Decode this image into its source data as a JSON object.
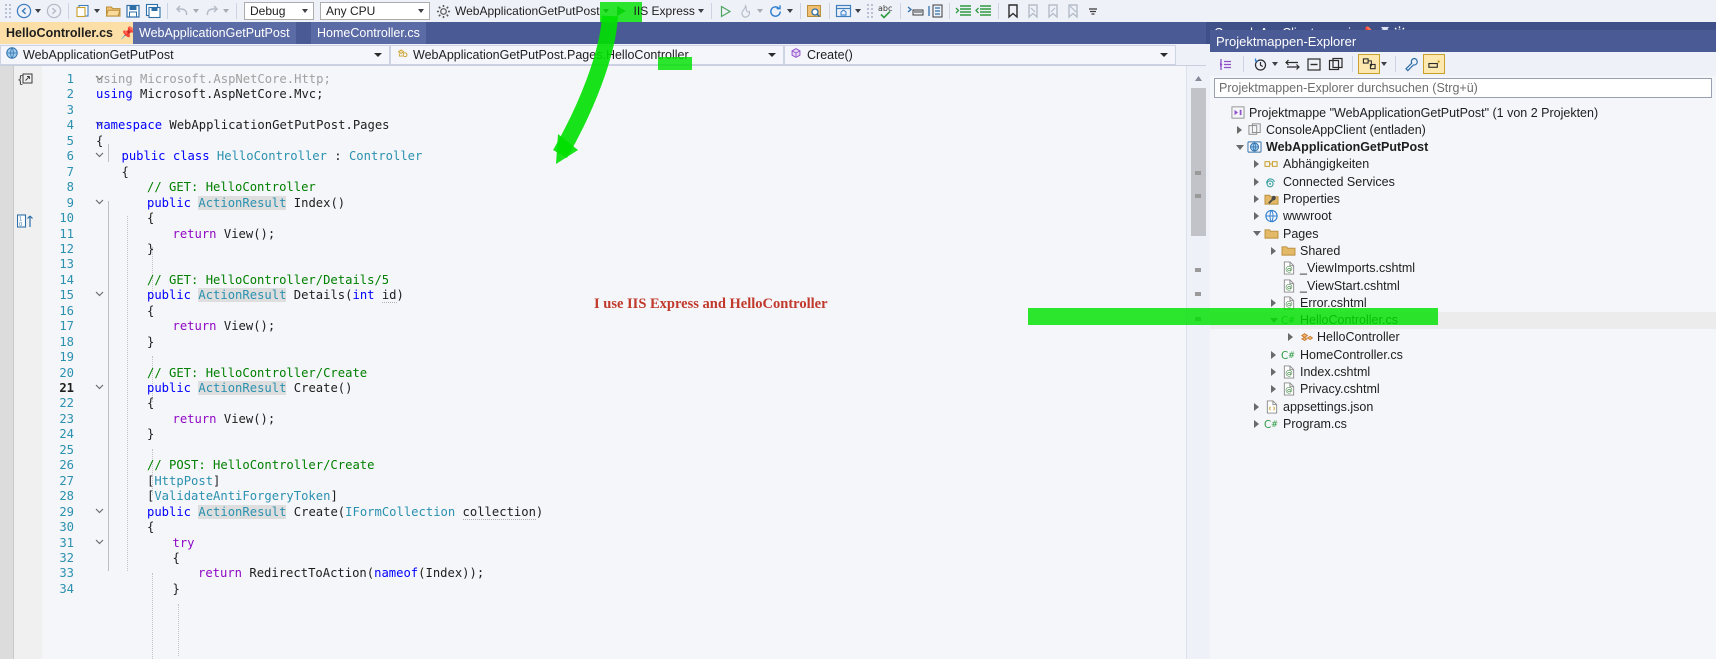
{
  "toolbar": {
    "nav_back_icon": "navigate-back-icon",
    "nav_forward_icon": "navigate-forward-icon",
    "new_item_icon": "new-item-icon",
    "open_icon": "open-file-icon",
    "save_icon": "save-icon",
    "save_all_icon": "save-all-icon",
    "undo_icon": "undo-icon",
    "redo_icon": "redo-icon",
    "config_value": "Debug",
    "platform_value": "Any CPU",
    "startup_project": "WebApplicationGetPutPost",
    "run_target": "IIS Express",
    "attach_icon": "attach-process-icon",
    "hot_reload_icon": "hot-reload-icon",
    "refresh_icon": "refresh-icon",
    "find_in_files_icon": "find-in-files-icon",
    "window_layout_icon": "window-layout-icon",
    "spell_icon": "spell-check-icon",
    "comment_icon": "comment-selection-icon",
    "uncomment_icon": "uncomment-selection-icon",
    "indent_icon": "increase-indent-icon",
    "outdent_icon": "decrease-indent-icon",
    "bookmark_icon": "toggle-bookmark-icon",
    "prev_bookmark_icon": "previous-bookmark-icon",
    "next_bookmark_icon": "next-bookmark-icon",
    "clear_bookmark_icon": "clear-bookmarks-icon",
    "overflow_icon": "toolbar-overflow-icon"
  },
  "tabs": {
    "items": [
      {
        "label": "HelloController.cs",
        "state": "active"
      },
      {
        "label": "WebApplicationGetPutPost",
        "state": "inactive"
      },
      {
        "label": "HomeController.cs",
        "state": "inactive"
      }
    ],
    "right_doc": "ConsoleAppClient.csproj",
    "pin_glyph": "✐",
    "close_glyph": "✕"
  },
  "navbar": {
    "project": "WebApplicationGetPutPost",
    "type": "WebApplicationGetPutPost.Pages.HelloController",
    "member": "Create()",
    "project_icon": "web-project-icon",
    "type_icon": "class-icon",
    "member_icon": "method-icon"
  },
  "editor": {
    "current_line": 21,
    "lines": [
      {
        "n": 1,
        "fold": "v",
        "indent": 0,
        "tokens": [
          {
            "t": "using Microsoft.AspNetCore.Http;",
            "c": "gry"
          }
        ]
      },
      {
        "n": 2,
        "fold": "",
        "indent": 0,
        "tokens": [
          {
            "t": "using",
            "c": "kw"
          },
          {
            "t": " Microsoft.AspNetCore.Mvc;",
            "c": "pl"
          }
        ]
      },
      {
        "n": 3,
        "fold": "",
        "indent": 0,
        "tokens": []
      },
      {
        "n": 4,
        "fold": "v",
        "indent": 0,
        "tokens": [
          {
            "t": "namespace",
            "c": "kw"
          },
          {
            "t": " WebApplicationGetPutPost.Pages",
            "c": "pl"
          }
        ]
      },
      {
        "n": 5,
        "fold": "",
        "indent": 0,
        "tokens": [
          {
            "t": "{",
            "c": "pl"
          }
        ]
      },
      {
        "n": 6,
        "fold": "v",
        "indent": 1,
        "tokens": [
          {
            "t": "public class ",
            "c": "kw"
          },
          {
            "t": "HelloController",
            "c": "typ"
          },
          {
            "t": " : ",
            "c": "pl"
          },
          {
            "t": "Controller",
            "c": "typ"
          }
        ]
      },
      {
        "n": 7,
        "fold": "",
        "indent": 1,
        "tokens": [
          {
            "t": "{",
            "c": "pl"
          }
        ]
      },
      {
        "n": 8,
        "fold": "",
        "indent": 2,
        "tokens": [
          {
            "t": "// GET: HelloController",
            "c": "cmt"
          }
        ]
      },
      {
        "n": 9,
        "fold": "v",
        "indent": 2,
        "tokens": [
          {
            "t": "public ",
            "c": "kw"
          },
          {
            "t": "ActionResult",
            "c": "typ hl"
          },
          {
            "t": " Index()",
            "c": "pl"
          }
        ]
      },
      {
        "n": 10,
        "fold": "",
        "indent": 2,
        "tokens": [
          {
            "t": "{",
            "c": "pl"
          }
        ]
      },
      {
        "n": 11,
        "fold": "",
        "indent": 3,
        "tokens": [
          {
            "t": "return",
            "c": "kwp"
          },
          {
            "t": " View();",
            "c": "pl"
          }
        ]
      },
      {
        "n": 12,
        "fold": "",
        "indent": 2,
        "tokens": [
          {
            "t": "}",
            "c": "pl"
          }
        ]
      },
      {
        "n": 13,
        "fold": "",
        "indent": 0,
        "tokens": []
      },
      {
        "n": 14,
        "fold": "",
        "indent": 2,
        "tokens": [
          {
            "t": "// GET: HelloController/Details/5",
            "c": "cmt"
          }
        ]
      },
      {
        "n": 15,
        "fold": "v",
        "indent": 2,
        "tokens": [
          {
            "t": "public ",
            "c": "kw"
          },
          {
            "t": "ActionResult",
            "c": "typ hl"
          },
          {
            "t": " Details(",
            "c": "pl"
          },
          {
            "t": "int",
            "c": "kw"
          },
          {
            "t": " ",
            "c": "pl"
          },
          {
            "t": "id",
            "c": "pl vdot"
          },
          {
            "t": ")",
            "c": "pl"
          }
        ]
      },
      {
        "n": 16,
        "fold": "",
        "indent": 2,
        "tokens": [
          {
            "t": "{",
            "c": "pl"
          }
        ]
      },
      {
        "n": 17,
        "fold": "",
        "indent": 3,
        "tokens": [
          {
            "t": "return",
            "c": "kwp"
          },
          {
            "t": " View();",
            "c": "pl"
          }
        ]
      },
      {
        "n": 18,
        "fold": "",
        "indent": 2,
        "tokens": [
          {
            "t": "}",
            "c": "pl"
          }
        ]
      },
      {
        "n": 19,
        "fold": "",
        "indent": 0,
        "tokens": []
      },
      {
        "n": 20,
        "fold": "",
        "indent": 2,
        "tokens": [
          {
            "t": "// GET: HelloController/Create",
            "c": "cmt"
          }
        ]
      },
      {
        "n": 21,
        "fold": "v",
        "indent": 2,
        "tokens": [
          {
            "t": "public ",
            "c": "kw"
          },
          {
            "t": "ActionResult",
            "c": "typ hl"
          },
          {
            "t": " Create()",
            "c": "pl"
          }
        ]
      },
      {
        "n": 22,
        "fold": "",
        "indent": 2,
        "tokens": [
          {
            "t": "{",
            "c": "pl"
          }
        ]
      },
      {
        "n": 23,
        "fold": "",
        "indent": 3,
        "tokens": [
          {
            "t": "return",
            "c": "kwp"
          },
          {
            "t": " View();",
            "c": "pl"
          }
        ]
      },
      {
        "n": 24,
        "fold": "",
        "indent": 2,
        "tokens": [
          {
            "t": "}",
            "c": "pl"
          }
        ]
      },
      {
        "n": 25,
        "fold": "",
        "indent": 0,
        "tokens": []
      },
      {
        "n": 26,
        "fold": "",
        "indent": 2,
        "tokens": [
          {
            "t": "// POST: HelloController/Create",
            "c": "cmt"
          }
        ]
      },
      {
        "n": 27,
        "fold": "",
        "indent": 2,
        "tokens": [
          {
            "t": "[",
            "c": "pl"
          },
          {
            "t": "HttpPost",
            "c": "typ"
          },
          {
            "t": "]",
            "c": "pl"
          }
        ]
      },
      {
        "n": 28,
        "fold": "",
        "indent": 2,
        "tokens": [
          {
            "t": "[",
            "c": "pl"
          },
          {
            "t": "ValidateAntiForgeryToken",
            "c": "typ"
          },
          {
            "t": "]",
            "c": "pl"
          }
        ]
      },
      {
        "n": 29,
        "fold": "v",
        "indent": 2,
        "tokens": [
          {
            "t": "public ",
            "c": "kw"
          },
          {
            "t": "ActionResult",
            "c": "typ hl"
          },
          {
            "t": " Create(",
            "c": "pl"
          },
          {
            "t": "IFormCollection",
            "c": "typ"
          },
          {
            "t": " ",
            "c": "pl"
          },
          {
            "t": "collection",
            "c": "pl vdot"
          },
          {
            "t": ")",
            "c": "pl"
          }
        ]
      },
      {
        "n": 30,
        "fold": "",
        "indent": 2,
        "tokens": [
          {
            "t": "{",
            "c": "pl"
          }
        ]
      },
      {
        "n": 31,
        "fold": "v",
        "indent": 3,
        "tokens": [
          {
            "t": "try",
            "c": "kwp"
          }
        ]
      },
      {
        "n": 32,
        "fold": "",
        "indent": 3,
        "tokens": [
          {
            "t": "{",
            "c": "pl"
          }
        ]
      },
      {
        "n": 33,
        "fold": "",
        "indent": 4,
        "tokens": [
          {
            "t": "return",
            "c": "kwp"
          },
          {
            "t": " RedirectToAction(",
            "c": "pl"
          },
          {
            "t": "nameof",
            "c": "kw"
          },
          {
            "t": "(Index));",
            "c": "pl"
          }
        ]
      },
      {
        "n": 34,
        "fold": "",
        "indent": 3,
        "tokens": [
          {
            "t": "}",
            "c": "pl"
          }
        ]
      }
    ],
    "annotation": "I use IIS Express and HelloController"
  },
  "solution_explorer": {
    "title": "Projektmappen-Explorer",
    "search_placeholder": "Projektmappen-Explorer durchsuchen (Strg+ü)",
    "toolbar_icons": [
      "collapse-all-icon",
      "pending-changes-icon",
      "sync-with-active-document-icon",
      "show-all-files-icon",
      "preview-selected-items-icon",
      "home-icon",
      "properties-icon",
      "switch-views-icon"
    ],
    "tree": [
      {
        "label": "Projektmappe \"WebApplicationGetPutPost\" (1 von 2 Projekten)",
        "depth": 0,
        "twisty": "",
        "icon": "solution-icon",
        "bold": false,
        "selected": false
      },
      {
        "label": "ConsoleAppClient (entladen)",
        "depth": 1,
        "twisty": "r",
        "icon": "unloaded-project-icon",
        "bold": false,
        "selected": false
      },
      {
        "label": "WebApplicationGetPutPost",
        "depth": 1,
        "twisty": "d",
        "icon": "web-project-icon",
        "bold": true,
        "selected": false
      },
      {
        "label": "Abhängigkeiten",
        "depth": 2,
        "twisty": "r",
        "icon": "dependencies-icon",
        "bold": false,
        "selected": false
      },
      {
        "label": "Connected Services",
        "depth": 2,
        "twisty": "r",
        "icon": "connected-services-icon",
        "bold": false,
        "selected": false
      },
      {
        "label": "Properties",
        "depth": 2,
        "twisty": "r",
        "icon": "properties-folder-icon",
        "bold": false,
        "selected": false
      },
      {
        "label": "wwwroot",
        "depth": 2,
        "twisty": "r",
        "icon": "wwwroot-icon",
        "bold": false,
        "selected": false
      },
      {
        "label": "Pages",
        "depth": 2,
        "twisty": "d",
        "icon": "folder-icon",
        "bold": false,
        "selected": false
      },
      {
        "label": "Shared",
        "depth": 3,
        "twisty": "r",
        "icon": "folder-icon",
        "bold": false,
        "selected": false
      },
      {
        "label": "_ViewImports.cshtml",
        "depth": 3,
        "twisty": "",
        "icon": "razor-file-icon",
        "bold": false,
        "selected": false
      },
      {
        "label": "_ViewStart.cshtml",
        "depth": 3,
        "twisty": "",
        "icon": "razor-file-icon",
        "bold": false,
        "selected": false
      },
      {
        "label": "Error.cshtml",
        "depth": 3,
        "twisty": "r",
        "icon": "razor-file-icon",
        "bold": false,
        "selected": false
      },
      {
        "label": "HelloController.cs",
        "depth": 3,
        "twisty": "d",
        "icon": "csharp-file-icon",
        "bold": false,
        "selected": true
      },
      {
        "label": "HelloController",
        "depth": 4,
        "twisty": "r",
        "icon": "class-member-icon",
        "bold": false,
        "selected": false
      },
      {
        "label": "HomeController.cs",
        "depth": 3,
        "twisty": "r",
        "icon": "csharp-file-icon",
        "bold": false,
        "selected": false
      },
      {
        "label": "Index.cshtml",
        "depth": 3,
        "twisty": "r",
        "icon": "razor-file-icon",
        "bold": false,
        "selected": false
      },
      {
        "label": "Privacy.cshtml",
        "depth": 3,
        "twisty": "r",
        "icon": "razor-file-icon",
        "bold": false,
        "selected": false
      },
      {
        "label": "appsettings.json",
        "depth": 2,
        "twisty": "r",
        "icon": "json-file-icon",
        "bold": false,
        "selected": false
      },
      {
        "label": "Program.cs",
        "depth": 2,
        "twisty": "r",
        "icon": "csharp-file-icon",
        "bold": false,
        "selected": false
      }
    ]
  },
  "annotations": {
    "highlight_color": "#00e000",
    "text_color": "#c0392b",
    "marks": [
      {
        "name": "arrow-to-iis-express"
      },
      {
        "name": "highlight-iis-express"
      },
      {
        "name": "highlight-hello-in-navbar"
      },
      {
        "name": "highlight-hellocontroller-node"
      }
    ]
  }
}
